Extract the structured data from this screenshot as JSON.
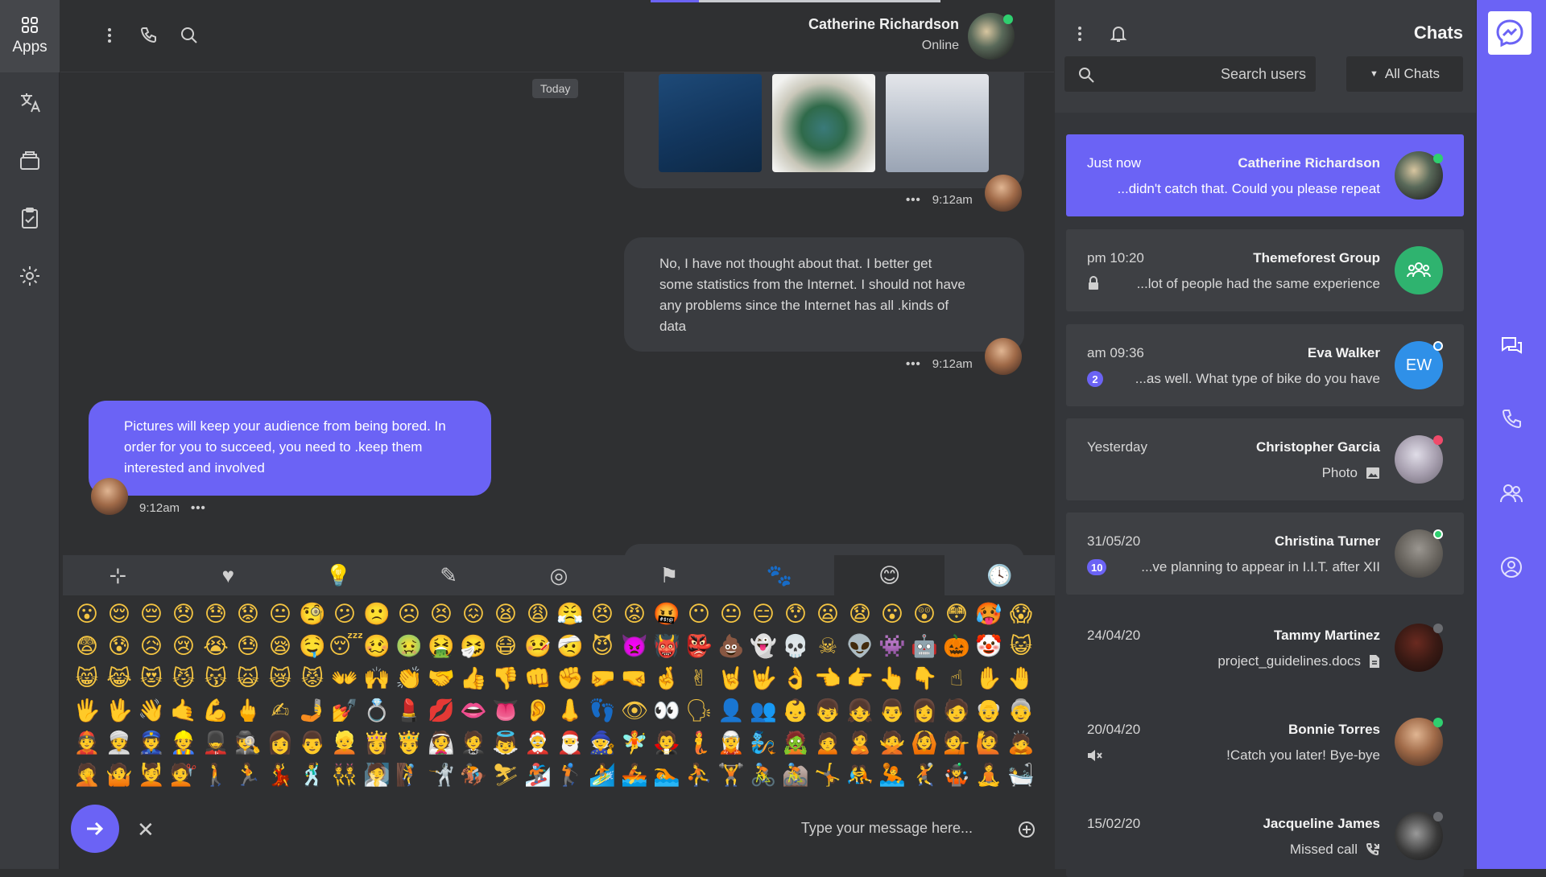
{
  "leftbar": {
    "apps_label": "Apps"
  },
  "chat_header": {
    "name": "Catherine Richardson",
    "status": "Online"
  },
  "conversation": {
    "date_separator": "Today",
    "messages": [
      {
        "time": "9:12am"
      },
      {
        "text": "No, I have not thought about that. I better get some statistics from the Internet. I should not have any problems since the Internet has all .kinds of data",
        "time": "9:12am"
      },
      {
        "text": "Pictures will keep your audience from being bored. In order for you to succeed, you need to .keep them interested and involved",
        "time": "9:12am"
      }
    ]
  },
  "emoji_picker": {
    "tabs": [
      "⊹",
      "♥",
      "💡",
      "✎",
      "◎",
      "⚑",
      "🐾",
      "😊",
      "🕓"
    ],
    "active_tab": 7,
    "emojis": "😮😌😔😞😓😟😐🧐😕🙁☹😣😖😫😩😤😠😡🤬😶😐😑😯😦😧😮😲😳🥵😱😨😰😥😢😭😓😪🤤😴🥴🤢🤮🤧😷🤒🤕😈👿👹👺💩👻💀☠👽👾🤖🎃🤡😺😸😹😻😼😽🙀😿😾👐🙌👏🤝👍👎👊✊🤛🤜🤞✌🤘🤟👌👈👉👆👇☝✋🤚🖐🖖👋🤙💪🖕✍🤳💅💍💄💋👄👅👂👃👣👁👀🗣👤👥👶👦👧👨👩🧑👴👵👲👳👮👷💂🕵👩👨👱👸🤴👰🤵👼🤶🎅🧙🧚🧛🧜🧝🧞🧟🙍🙎🙅🙆💁🙋🙇🤦🤷💆💇🚶🏃💃🕺👯🧖🧗🤺🏇⛷🏂🏌🏄🚣🏊⛹🏋🚴🚵🤸🤼🤽🤾🤹🧘🛀🛌"
  },
  "composer": {
    "placeholder": "Type your message here..."
  },
  "sidebar": {
    "title": "Chats",
    "search_placeholder": "Search users",
    "filter_label": "All Chats",
    "chats": [
      {
        "time": "Just now",
        "name": "Catherine Richardson",
        "preview": "...didn't catch that. Could you please repeat",
        "active": true
      },
      {
        "time": "pm 10:20",
        "name": "Themeforest Group",
        "preview": "...lot of people had the same experience"
      },
      {
        "time": "am 09:36",
        "name": "Eva Walker",
        "preview": "...as well. What type of bike do you have",
        "badge": "2",
        "initials": "EW"
      },
      {
        "time": "Yesterday",
        "name": "Christopher Garcia",
        "preview": "Photo"
      },
      {
        "time": "31/05/20",
        "name": "Christina Turner",
        "preview": "...ve planning to appear in I.I.T. after XII",
        "badge": "10"
      },
      {
        "time": "24/04/20",
        "name": "Tammy Martinez",
        "preview": "project_guidelines.docs"
      },
      {
        "time": "20/04/20",
        "name": "Bonnie Torres",
        "preview": "!Catch you later! Bye-bye"
      },
      {
        "time": "15/02/20",
        "name": "Jacqueline James",
        "preview": "Missed call"
      }
    ]
  },
  "colors": {
    "accent": "#6b63f5",
    "online": "#2fcf6f",
    "busy": "#f04a6a",
    "group_green": "#2fb36f",
    "eva_blue": "#2f90e8"
  }
}
